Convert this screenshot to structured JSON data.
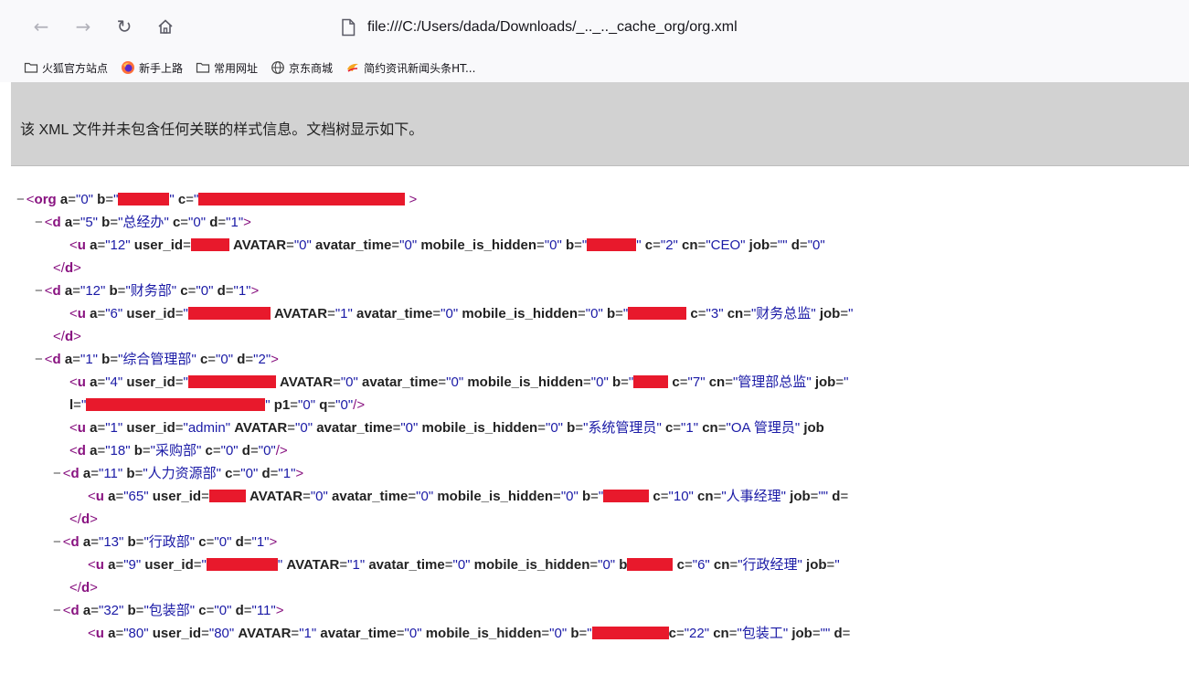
{
  "browser": {
    "url": "file:///C:/Users/dada/Downloads/_.._.._cache_org/org.xml",
    "bookmarks": [
      {
        "label": "火狐官方站点",
        "icon": "folder-icon"
      },
      {
        "label": "新手上路",
        "icon": "firefox-icon"
      },
      {
        "label": "常用网址",
        "icon": "folder-icon"
      },
      {
        "label": "京东商城",
        "icon": "globe-icon"
      },
      {
        "label": "简约资讯新闻头条HT...",
        "icon": "news-icon"
      }
    ]
  },
  "banner": {
    "text": "该 XML 文件并未包含任何关联的样式信息。文档树显示如下。"
  },
  "xml": {
    "org": {
      "a": "0"
    },
    "d1": {
      "a": "5",
      "b": "总经办",
      "c": "0",
      "d": "1"
    },
    "u1": {
      "a": "12",
      "avatar": "0",
      "avatar_time": "0",
      "mobile_is_hidden": "0",
      "c": "2",
      "cn": "CEO",
      "job": "",
      "d": "0"
    },
    "d2": {
      "a": "12",
      "b": "财务部",
      "c": "0",
      "d": "1"
    },
    "u2": {
      "a": "6",
      "avatar": "1",
      "avatar_time": "0",
      "mobile_is_hidden": "0",
      "c": "3",
      "cn": "财务总监"
    },
    "d3": {
      "a": "1",
      "b": "综合管理部",
      "c": "0",
      "d": "2"
    },
    "u3": {
      "a": "4",
      "avatar": "0",
      "avatar_time": "0",
      "mobile_is_hidden": "0",
      "c": "7",
      "cn": "管理部总监",
      "p1": "0",
      "q": "0"
    },
    "u4": {
      "a": "1",
      "user_id": "admin",
      "avatar": "0",
      "avatar_time": "0",
      "mobile_is_hidden": "0",
      "b": "系统管理员",
      "c": "1",
      "cn": "OA 管理员"
    },
    "d4": {
      "a": "18",
      "b": "采购部",
      "c": "0",
      "d": "0"
    },
    "d5": {
      "a": "11",
      "b": "人力资源部",
      "c": "0",
      "d": "1"
    },
    "u5": {
      "a": "65",
      "avatar": "0",
      "avatar_time": "0",
      "mobile_is_hidden": "0",
      "c": "10",
      "cn": "人事经理",
      "job": ""
    },
    "d6": {
      "a": "13",
      "b": "行政部",
      "c": "0",
      "d": "1"
    },
    "u6": {
      "a": "9",
      "avatar": "1",
      "avatar_time": "0",
      "mobile_is_hidden": "0",
      "c": "6",
      "cn": "行政经理"
    },
    "d7": {
      "a": "32",
      "b": "包装部",
      "c": "0",
      "d": "11"
    },
    "u7": {
      "a": "80",
      "user_id": "80",
      "avatar": "1",
      "avatar_time": "0",
      "mobile_is_hidden": "0",
      "c": "22",
      "cn": "包装工",
      "job": ""
    }
  }
}
